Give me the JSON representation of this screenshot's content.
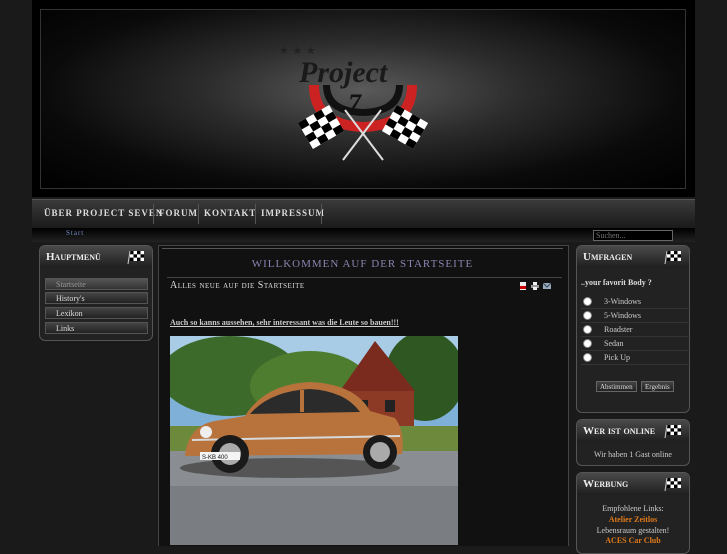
{
  "header": {
    "logo_text": "Project",
    "logo_number": "7"
  },
  "nav": {
    "items": [
      "ÜBER PROJECT SEVEN",
      "FORUM",
      "KONTAKT",
      "IMPRESSUM"
    ]
  },
  "breadcrumb": "Start",
  "search": {
    "placeholder": "Suchen..."
  },
  "main_menu": {
    "title": "Hauptmenü",
    "items": [
      "Startseite",
      "History's",
      "Lexikon",
      "Links"
    ]
  },
  "content": {
    "welcome": "WILLKOMMEN AUF DER STARTSEITE",
    "article_title": "Alles neue auf die Startseite",
    "article_link": "Auch so kanns aussehen, sehr interessant was die Leute so bauen!!!",
    "plate_text": "S-KB 400"
  },
  "poll": {
    "title": "Umfragen",
    "question": "..your favorit Body ?",
    "options": [
      "3-Windows",
      "5-Windows",
      "Roadster",
      "Sedan",
      "Pick Up"
    ],
    "vote_label": "Abstimmen",
    "result_label": "Ergebnis"
  },
  "online": {
    "title": "Wer ist online",
    "text": "Wir haben 1 Gast online"
  },
  "ads": {
    "title": "Werbung",
    "intro": "Empfohlene Links:",
    "link1": "Atelier Zeitlos",
    "text2": "Lebensraum gestalten!",
    "link3": "ACES Car Club"
  },
  "colors": {
    "accent_orange": "#e07a1a",
    "welcome_purple": "#8d83b0",
    "link_blue": "#7a8fd0"
  }
}
